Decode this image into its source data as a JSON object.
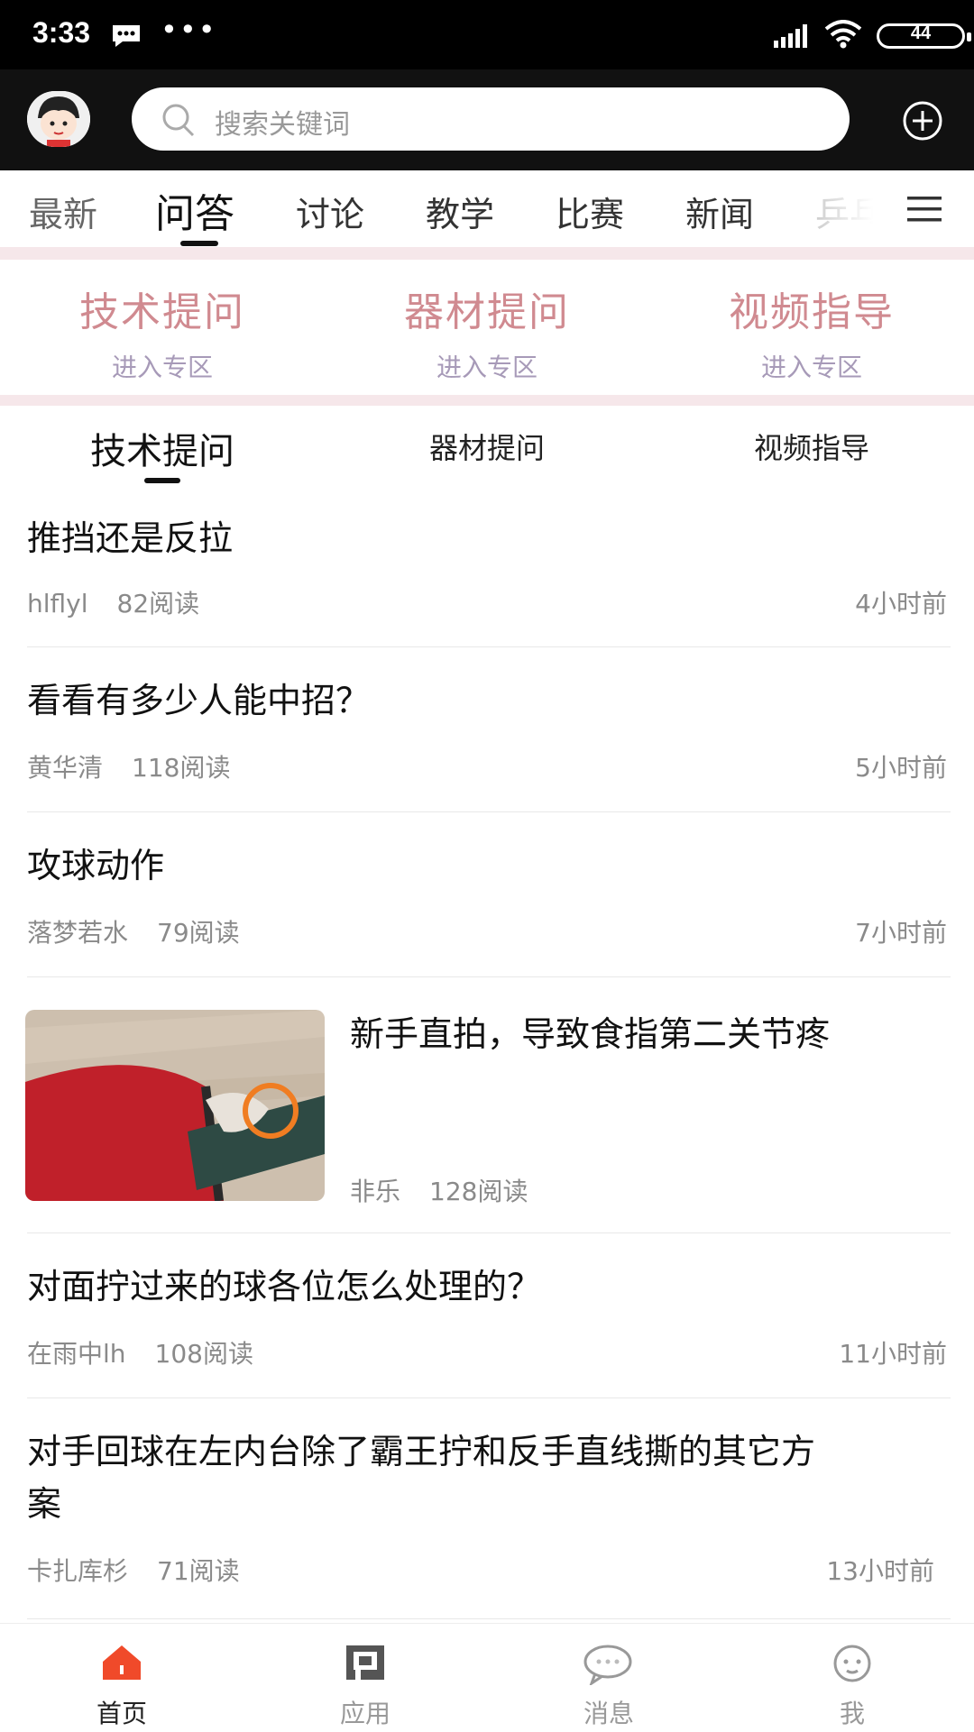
{
  "status_bar": {
    "time": "3:33",
    "battery": "44"
  },
  "search": {
    "placeholder": "搜索关键词"
  },
  "categories": [
    "最新",
    "问答",
    "讨论",
    "教学",
    "比赛",
    "新闻",
    "乒乓"
  ],
  "active_category": "问答",
  "zones": [
    {
      "title": "技术提问",
      "subtitle": "进入专区"
    },
    {
      "title": "器材提问",
      "subtitle": "进入专区"
    },
    {
      "title": "视频指导",
      "subtitle": "进入专区"
    }
  ],
  "subtabs": [
    "技术提问",
    "器材提问",
    "视频指导"
  ],
  "active_subtab": "技术提问",
  "posts": [
    {
      "title": "推挡还是反拉",
      "author": "hlflyl",
      "reads": "82阅读",
      "time": "4小时前"
    },
    {
      "title": "看看有多少人能中招？",
      "author": "黄华清",
      "reads": "118阅读",
      "time": "5小时前"
    },
    {
      "title": "攻球动作",
      "author": "落梦若水",
      "reads": "79阅读",
      "time": "7小时前"
    },
    {
      "title": "新手直拍，导致食指第二关节疼",
      "author": "非乐",
      "reads": "128阅读",
      "time": ""
    },
    {
      "title": "对面拧过来的球各位怎么处理的？",
      "author": "在雨中lh",
      "reads": "108阅读",
      "time": "11小时前"
    },
    {
      "title": "对手回球在左内台除了霸王拧和反手直线撕的其它方",
      "title_line2": "案",
      "author": "卡扎库杉",
      "reads": "71阅读",
      "time": "13小时前"
    }
  ],
  "bottom_nav": [
    {
      "label": "首页",
      "icon": "home-icon"
    },
    {
      "label": "应用",
      "icon": "apps-icon"
    },
    {
      "label": "消息",
      "icon": "message-icon"
    },
    {
      "label": "我",
      "icon": "profile-icon"
    }
  ],
  "colors": {
    "accent": "#f04a2a",
    "zone_title": "#d08a90",
    "zone_sub": "#a79ab8",
    "divider_band": "#f6e7ea"
  }
}
